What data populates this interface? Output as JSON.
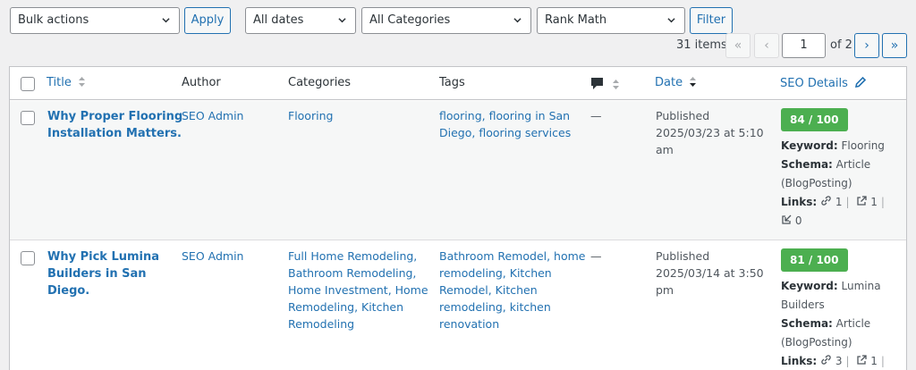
{
  "toolbar": {
    "bulk_actions": "Bulk actions",
    "apply": "Apply",
    "dates": "All dates",
    "categories": "All Categories",
    "seo_filter": "Rank Math",
    "filter": "Filter"
  },
  "pagination": {
    "items": "31 items",
    "first": "«",
    "prev": "‹",
    "current_page": "1",
    "of": "of 2",
    "next": "›",
    "last": "»"
  },
  "columns": {
    "title": "Title",
    "author": "Author",
    "categories": "Categories",
    "tags": "Tags",
    "date": "Date",
    "seo": "SEO Details"
  },
  "rows": [
    {
      "title_lines": [
        "Why Proper Flooring",
        "Installation Matters."
      ],
      "author": "SEO Admin",
      "categories_lines": [
        "Flooring"
      ],
      "tags_lines": [
        "flooring, flooring in San",
        "Diego, flooring services"
      ],
      "comments": "—",
      "date_lines": [
        "Published",
        "2025/03/23 at 5:10",
        "am"
      ],
      "score": "84 / 100",
      "keyword_label": "Keyword:",
      "keyword": "Flooring",
      "schema_label": "Schema:",
      "schema_lines": [
        "Article",
        "(BlogPosting)"
      ],
      "links_label": "Links:",
      "internal": "1",
      "external": "1",
      "incoming": "0"
    },
    {
      "title_lines": [
        "Why Pick Lumina",
        "Builders in San",
        "Diego."
      ],
      "author": "SEO Admin",
      "categories_lines": [
        "Full Home Remodeling,",
        "Bathroom Remodeling,",
        "Home Investment, Home",
        "Remodeling, Kitchen",
        "Remodeling"
      ],
      "tags_lines": [
        "Bathroom Remodel, home",
        "remodeling, Kitchen",
        "Remodel, Kitchen",
        "remodeling, kitchen",
        "renovation"
      ],
      "comments": "—",
      "date_lines": [
        "Published",
        "2025/03/14 at 3:50",
        "pm"
      ],
      "score": "81 / 100",
      "keyword_label": "Keyword:",
      "keyword_lines": [
        "Lumina",
        "Builders"
      ],
      "schema_label": "Schema:",
      "schema_lines": [
        "Article",
        "(BlogPosting)"
      ],
      "links_label": "Links:",
      "internal": "3",
      "external": "1"
    }
  ]
}
